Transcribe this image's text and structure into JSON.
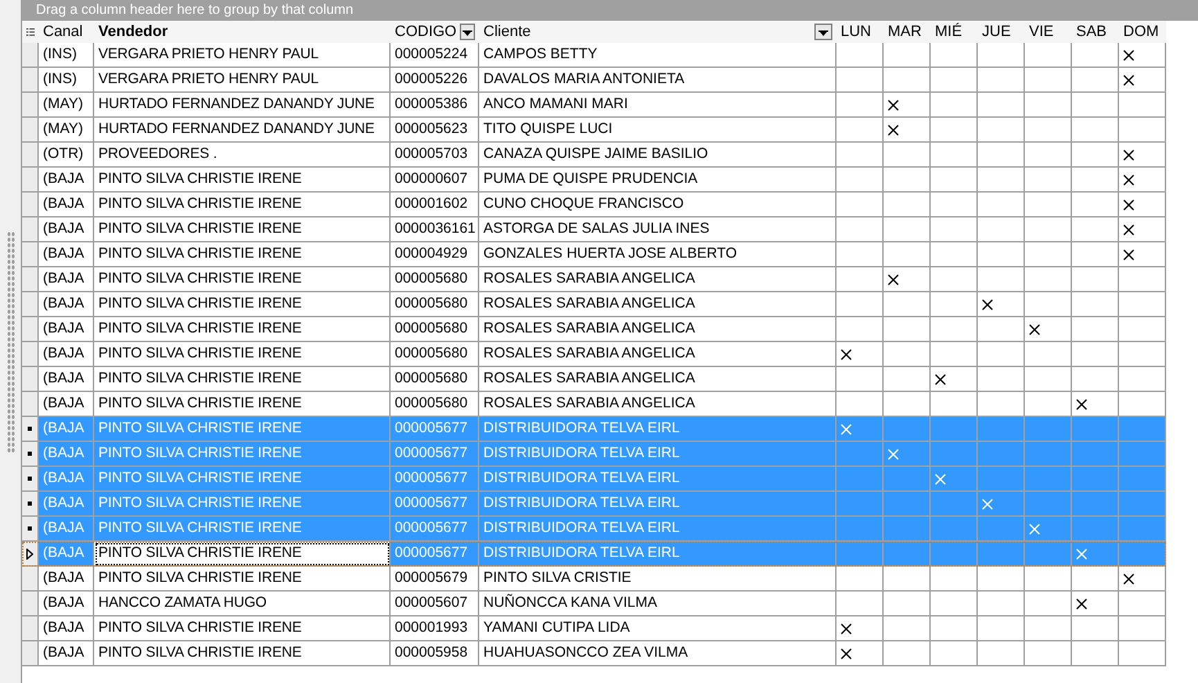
{
  "group_panel": {
    "hint": "Drag a column header here to group by that column"
  },
  "columns": [
    {
      "label": "Canal",
      "kind": "plain"
    },
    {
      "label": "Vendedor",
      "kind": "bold"
    },
    {
      "label": "CODIGO",
      "kind": "filter"
    },
    {
      "label": "Cliente",
      "kind": "filter"
    },
    {
      "label": "LUN",
      "kind": "day"
    },
    {
      "label": "MAR",
      "kind": "day"
    },
    {
      "label": "MIÉ",
      "kind": "day"
    },
    {
      "label": "JUE",
      "kind": "day"
    },
    {
      "label": "VIE",
      "kind": "day"
    },
    {
      "label": "SAB",
      "kind": "day"
    },
    {
      "label": "DOM",
      "kind": "day"
    }
  ],
  "rows": [
    {
      "canal": "(INS)",
      "vendedor": "VERGARA PRIETO HENRY PAUL",
      "codigo": "000005224",
      "cliente": "CAMPOS BETTY",
      "days": [
        false,
        false,
        false,
        false,
        false,
        false,
        true
      ],
      "selected": false,
      "current": false
    },
    {
      "canal": "(INS)",
      "vendedor": "VERGARA PRIETO HENRY PAUL",
      "codigo": "000005226",
      "cliente": "DAVALOS MARIA ANTONIETA",
      "days": [
        false,
        false,
        false,
        false,
        false,
        false,
        true
      ],
      "selected": false,
      "current": false
    },
    {
      "canal": "(MAY)",
      "vendedor": "HURTADO FERNANDEZ DANANDY JUNE",
      "codigo": "000005386",
      "cliente": "ANCO MAMANI MARI",
      "days": [
        false,
        true,
        false,
        false,
        false,
        false,
        false
      ],
      "selected": false,
      "current": false
    },
    {
      "canal": "(MAY)",
      "vendedor": "HURTADO FERNANDEZ DANANDY JUNE",
      "codigo": "000005623",
      "cliente": "TITO QUISPE LUCI",
      "days": [
        false,
        true,
        false,
        false,
        false,
        false,
        false
      ],
      "selected": false,
      "current": false
    },
    {
      "canal": "(OTR)",
      "vendedor": "PROVEEDORES .",
      "codigo": "000005703",
      "cliente": "CANAZA QUISPE JAIME BASILIO",
      "days": [
        false,
        false,
        false,
        false,
        false,
        false,
        true
      ],
      "selected": false,
      "current": false
    },
    {
      "canal": "(BAJA",
      "vendedor": "PINTO SILVA CHRISTIE IRENE",
      "codigo": "000000607",
      "cliente": "PUMA DE QUISPE PRUDENCIA",
      "days": [
        false,
        false,
        false,
        false,
        false,
        false,
        true
      ],
      "selected": false,
      "current": false
    },
    {
      "canal": "(BAJA",
      "vendedor": "PINTO SILVA CHRISTIE IRENE",
      "codigo": "000001602",
      "cliente": "CUNO CHOQUE FRANCISCO",
      "days": [
        false,
        false,
        false,
        false,
        false,
        false,
        true
      ],
      "selected": false,
      "current": false
    },
    {
      "canal": "(BAJA",
      "vendedor": "PINTO SILVA CHRISTIE IRENE",
      "codigo": "0000036161",
      "cliente": "ASTORGA DE SALAS JULIA INES",
      "days": [
        false,
        false,
        false,
        false,
        false,
        false,
        true
      ],
      "selected": false,
      "current": false
    },
    {
      "canal": "(BAJA",
      "vendedor": "PINTO SILVA CHRISTIE IRENE",
      "codigo": "000004929",
      "cliente": "GONZALES HUERTA JOSE ALBERTO",
      "days": [
        false,
        false,
        false,
        false,
        false,
        false,
        true
      ],
      "selected": false,
      "current": false
    },
    {
      "canal": "(BAJA",
      "vendedor": "PINTO SILVA CHRISTIE IRENE",
      "codigo": "000005680",
      "cliente": "ROSALES SARABIA ANGELICA",
      "days": [
        false,
        true,
        false,
        false,
        false,
        false,
        false
      ],
      "selected": false,
      "current": false
    },
    {
      "canal": "(BAJA",
      "vendedor": "PINTO SILVA CHRISTIE IRENE",
      "codigo": "000005680",
      "cliente": "ROSALES SARABIA ANGELICA",
      "days": [
        false,
        false,
        false,
        true,
        false,
        false,
        false
      ],
      "selected": false,
      "current": false
    },
    {
      "canal": "(BAJA",
      "vendedor": "PINTO SILVA CHRISTIE IRENE",
      "codigo": "000005680",
      "cliente": "ROSALES SARABIA ANGELICA",
      "days": [
        false,
        false,
        false,
        false,
        true,
        false,
        false
      ],
      "selected": false,
      "current": false
    },
    {
      "canal": "(BAJA",
      "vendedor": "PINTO SILVA CHRISTIE IRENE",
      "codigo": "000005680",
      "cliente": "ROSALES SARABIA ANGELICA",
      "days": [
        true,
        false,
        false,
        false,
        false,
        false,
        false
      ],
      "selected": false,
      "current": false
    },
    {
      "canal": "(BAJA",
      "vendedor": "PINTO SILVA CHRISTIE IRENE",
      "codigo": "000005680",
      "cliente": "ROSALES SARABIA ANGELICA",
      "days": [
        false,
        false,
        true,
        false,
        false,
        false,
        false
      ],
      "selected": false,
      "current": false
    },
    {
      "canal": "(BAJA",
      "vendedor": "PINTO SILVA CHRISTIE IRENE",
      "codigo": "000005680",
      "cliente": "ROSALES SARABIA ANGELICA",
      "days": [
        false,
        false,
        false,
        false,
        false,
        true,
        false
      ],
      "selected": false,
      "current": false
    },
    {
      "canal": "(BAJA",
      "vendedor": "PINTO SILVA CHRISTIE IRENE",
      "codigo": "000005677",
      "cliente": "DISTRIBUIDORA TELVA EIRL",
      "days": [
        true,
        false,
        false,
        false,
        false,
        false,
        false
      ],
      "selected": true,
      "current": false
    },
    {
      "canal": "(BAJA",
      "vendedor": "PINTO SILVA CHRISTIE IRENE",
      "codigo": "000005677",
      "cliente": "DISTRIBUIDORA TELVA EIRL",
      "days": [
        false,
        true,
        false,
        false,
        false,
        false,
        false
      ],
      "selected": true,
      "current": false
    },
    {
      "canal": "(BAJA",
      "vendedor": "PINTO SILVA CHRISTIE IRENE",
      "codigo": "000005677",
      "cliente": "DISTRIBUIDORA TELVA EIRL",
      "days": [
        false,
        false,
        true,
        false,
        false,
        false,
        false
      ],
      "selected": true,
      "current": false
    },
    {
      "canal": "(BAJA",
      "vendedor": "PINTO SILVA CHRISTIE IRENE",
      "codigo": "000005677",
      "cliente": "DISTRIBUIDORA TELVA EIRL",
      "days": [
        false,
        false,
        false,
        true,
        false,
        false,
        false
      ],
      "selected": true,
      "current": false
    },
    {
      "canal": "(BAJA",
      "vendedor": "PINTO SILVA CHRISTIE IRENE",
      "codigo": "000005677",
      "cliente": "DISTRIBUIDORA TELVA EIRL",
      "days": [
        false,
        false,
        false,
        false,
        true,
        false,
        false
      ],
      "selected": true,
      "current": false
    },
    {
      "canal": "(BAJA",
      "vendedor": "PINTO SILVA CHRISTIE IRENE",
      "codigo": "000005677",
      "cliente": "DISTRIBUIDORA TELVA EIRL",
      "days": [
        false,
        false,
        false,
        false,
        false,
        true,
        false
      ],
      "selected": true,
      "current": true
    },
    {
      "canal": "(BAJA",
      "vendedor": "PINTO SILVA CHRISTIE IRENE",
      "codigo": "000005679",
      "cliente": "PINTO SILVA CRISTIE",
      "days": [
        false,
        false,
        false,
        false,
        false,
        false,
        true
      ],
      "selected": false,
      "current": false
    },
    {
      "canal": "(BAJA",
      "vendedor": "HANCCO ZAMATA HUGO",
      "codigo": "000005607",
      "cliente": "NUÑONCCA KANA VILMA",
      "days": [
        false,
        false,
        false,
        false,
        false,
        true,
        false
      ],
      "selected": false,
      "current": false
    },
    {
      "canal": "(BAJA",
      "vendedor": "PINTO SILVA CHRISTIE IRENE",
      "codigo": "000001993",
      "cliente": "YAMANI CUTIPA LIDA",
      "days": [
        true,
        false,
        false,
        false,
        false,
        false,
        false
      ],
      "selected": false,
      "current": false
    },
    {
      "canal": "(BAJA",
      "vendedor": "PINTO SILVA CHRISTIE IRENE",
      "codigo": "000005958",
      "cliente": "HUAHUASONCCO ZEA VILMA",
      "days": [
        true,
        false,
        false,
        false,
        false,
        false,
        false
      ],
      "selected": false,
      "current": false
    }
  ]
}
